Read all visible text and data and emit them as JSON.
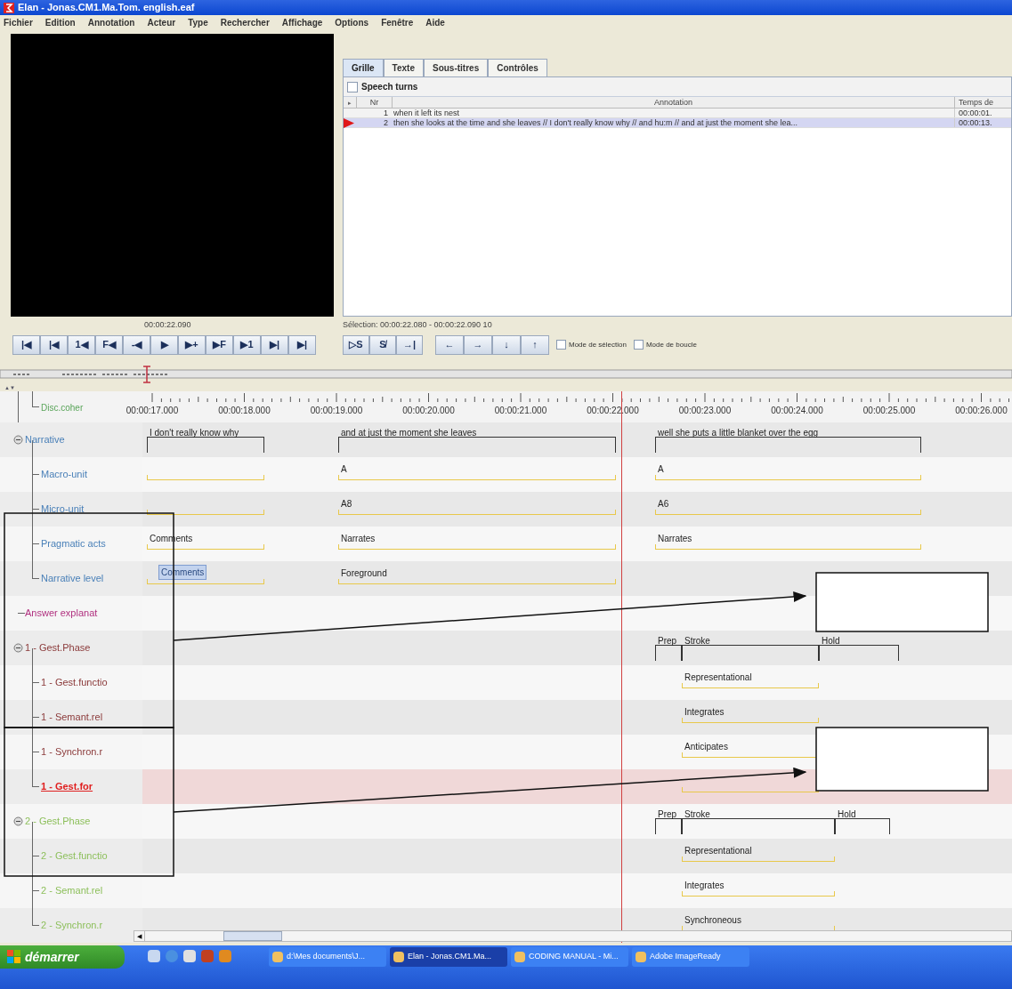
{
  "window": {
    "title": "Elan - Jonas.CM1.Ma.Tom. english.eaf"
  },
  "menu": [
    "Fichier",
    "Edition",
    "Annotation",
    "Acteur",
    "Type",
    "Rechercher",
    "Affichage",
    "Options",
    "Fenêtre",
    "Aide"
  ],
  "media": {
    "time": "00:00:22.090",
    "buttons": [
      "|◀",
      "|◀",
      "1◀",
      "F◀",
      "-◀",
      "▶",
      "▶+",
      "▶F",
      "▶1",
      "▶|",
      "▶|"
    ]
  },
  "selection": {
    "text": "Sélection: 00:00:22.080 - 00:00:22.090  10",
    "buttons": [
      "▷S",
      "S̸",
      "→|"
    ],
    "nav_buttons": [
      "←",
      "→",
      "↓",
      "↑"
    ],
    "options": [
      {
        "label": "Mode de sélection",
        "checked": false
      },
      {
        "label": "Mode de boucle",
        "checked": false
      }
    ]
  },
  "viewer": {
    "tabs": [
      {
        "label": "Grille",
        "selected": true
      },
      {
        "label": "Texte",
        "selected": false
      },
      {
        "label": "Sous-titres",
        "selected": false
      },
      {
        "label": "Contrôles",
        "selected": false
      }
    ],
    "tier": {
      "label": "Speech turns",
      "checked": false
    },
    "table": {
      "marker": "▸",
      "columns": [
        "Nr",
        "Annotation",
        "Temps de"
      ],
      "rows": [
        {
          "nr": "1",
          "annotation": "when it left its nest",
          "time": "00:00:01.",
          "selected": false
        },
        {
          "nr": "2",
          "annotation": "then she looks at the time and she leaves // I don't really know why // and hu:m // and at just the moment she lea...",
          "time": "00:00:13.",
          "selected": true
        }
      ]
    }
  },
  "timeline": {
    "ruler": [
      "00:00:17.000",
      "00:00:18.000",
      "00:00:19.000",
      "00:00:20.000",
      "00:00:21.000",
      "00:00:22.000",
      "00:00:23.000",
      "00:00:24.000",
      "00:00:25.000",
      "00:00:26.000"
    ],
    "scroll_arrows": "▲▼",
    "scroll_left": "◀",
    "partial_tier": {
      "name": "Disc.coher",
      "color": "#5aa55a"
    },
    "tiers": [
      {
        "name": "Narrative",
        "color": "#4a80b8",
        "kind": "main",
        "expanded": true,
        "selected": false,
        "annotations": [
          {
            "kind": "text",
            "text": "I don't really know why"
          },
          {
            "kind": "text",
            "text": "and at just the moment she leaves"
          },
          {
            "kind": "text",
            "text": "well she puts a little blanket over the egg"
          }
        ],
        "children": [
          {
            "name": "Macro-unit",
            "color": "#4a80b8",
            "kind": "dependent",
            "selected": false,
            "annotations": [
              {
                "kind": "blank"
              },
              {
                "kind": "text",
                "text": "A"
              },
              {
                "kind": "text",
                "text": "A"
              }
            ]
          },
          {
            "name": "Micro-unit",
            "color": "#4a80b8",
            "kind": "dependent",
            "selected": false,
            "annotations": [
              {
                "kind": "blank"
              },
              {
                "kind": "text",
                "text": "A8"
              },
              {
                "kind": "text",
                "text": "A6"
              }
            ]
          },
          {
            "name": "Pragmatic acts",
            "color": "#4a80b8",
            "kind": "dependent",
            "selected": false,
            "annotations": [
              {
                "kind": "text",
                "text": "Comments"
              },
              {
                "kind": "text",
                "text": "Narrates"
              },
              {
                "kind": "text",
                "text": "Narrates"
              }
            ]
          },
          {
            "name": "Narrative level",
            "color": "#4a80b8",
            "kind": "dependent",
            "selected": false,
            "annotations": [
              {
                "kind": "editing",
                "text": "Comments"
              },
              {
                "kind": "text",
                "text": "Foreground"
              }
            ]
          }
        ]
      },
      {
        "name": "Answer explanat",
        "color": "#b0307f",
        "selected": false
      },
      {
        "name": "1 - Gest.Phase",
        "color": "#8b3a3a",
        "kind": "main",
        "expanded": true,
        "selected": false,
        "annotations": [
          {
            "kind": "text",
            "text": "Prep"
          },
          {
            "kind": "text",
            "text": "Stroke"
          },
          {
            "kind": "text",
            "text": "Hold"
          }
        ],
        "children": [
          {
            "name": "1 - Gest.functio",
            "color": "#8b3a3a",
            "kind": "dependent",
            "selected": false,
            "annotations": [
              {
                "kind": "text",
                "text": "Representational"
              }
            ]
          },
          {
            "name": "1 - Semant.rel",
            "color": "#8b3a3a",
            "kind": "dependent",
            "selected": false,
            "annotations": [
              {
                "kind": "text",
                "text": "Integrates"
              }
            ]
          },
          {
            "name": "1 - Synchron.r",
            "color": "#8b3a3a",
            "kind": "dependent",
            "selected": false,
            "annotations": [
              {
                "kind": "text",
                "text": "Anticipates"
              }
            ]
          },
          {
            "name": "1 - Gest.for",
            "color": "#e02020",
            "kind": "dependent",
            "selected": true,
            "annotations": [
              {
                "kind": "blank"
              }
            ]
          }
        ]
      },
      {
        "name": "2 - Gest.Phase",
        "color": "#8cbf5a",
        "kind": "main",
        "expanded": true,
        "selected": false,
        "annotations": [
          {
            "kind": "text",
            "text": "Prep"
          },
          {
            "kind": "text",
            "text": "Stroke"
          },
          {
            "kind": "text",
            "text": "Hold"
          }
        ],
        "children": [
          {
            "name": "2 - Gest.functio",
            "color": "#8cbf5a",
            "kind": "dependent",
            "selected": false,
            "annotations": [
              {
                "kind": "text",
                "text": "Representational"
              }
            ]
          },
          {
            "name": "2 - Semant.rel",
            "color": "#8cbf5a",
            "kind": "dependent",
            "selected": false,
            "annotations": [
              {
                "kind": "text",
                "text": "Integrates"
              }
            ]
          },
          {
            "name": "2 - Synchron.r",
            "color": "#8cbf5a",
            "kind": "dependent",
            "selected": false,
            "annotations": [
              {
                "kind": "text",
                "text": "Synchroneous"
              }
            ]
          }
        ]
      }
    ]
  },
  "taskbar": {
    "start": "démarrer",
    "tasks": [
      {
        "label": "d:\\Mes documents\\J...",
        "selected": false
      },
      {
        "label": "Elan - Jonas.CM1.Ma...",
        "selected": true
      },
      {
        "label": "CODING MANUAL - Mi...",
        "selected": false
      },
      {
        "label": "Adobe ImageReady",
        "selected": false
      }
    ]
  }
}
